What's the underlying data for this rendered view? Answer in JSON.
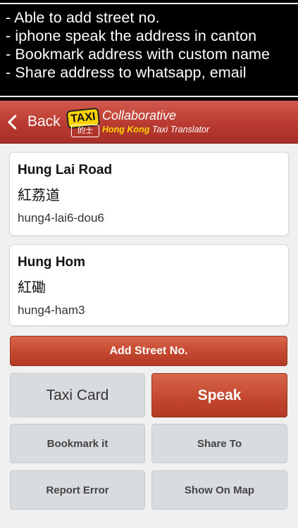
{
  "promo": {
    "lines": [
      "- Able to add street no.",
      "- iphone speak the address in canton",
      "- Bookmark address with custom name",
      "- Share address to whatsapp, email"
    ]
  },
  "navbar": {
    "back_label": "Back",
    "logo": {
      "badge": "TAXI",
      "badge_sub": "的士",
      "title": "Collaborative",
      "sub_hk": "Hong Kong",
      "sub_rest": "Taxi Translator"
    }
  },
  "results": [
    {
      "name": "Hung Lai Road",
      "chinese": "紅荔道",
      "romanization": "hung4-lai6-dou6"
    },
    {
      "name": "Hung Hom",
      "chinese": "紅磡",
      "romanization": "hung4-ham3"
    }
  ],
  "actions": {
    "add_street": "Add Street No.",
    "taxi_card": "Taxi Card",
    "speak": "Speak",
    "bookmark": "Bookmark it",
    "share": "Share To",
    "report": "Report Error",
    "map": "Show On Map"
  },
  "colors": {
    "accent_red": "#c2462e",
    "navbar_red": "#b93a30",
    "logo_yellow": "#ffd400"
  }
}
